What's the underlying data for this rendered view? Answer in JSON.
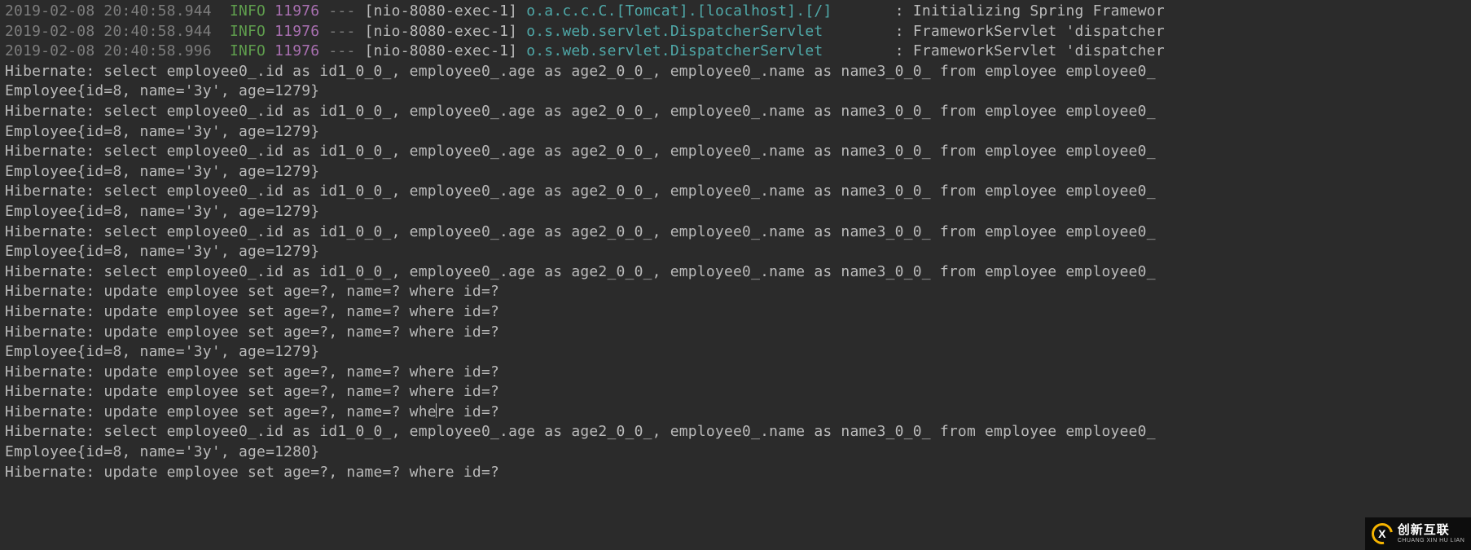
{
  "log_lines": [
    {
      "ts": "2019-02-08 20:40:58.944",
      "level": "INFO",
      "pid": "11976",
      "dash": "---",
      "thread": "[nio-8080-exec-1]",
      "logger": "o.a.c.c.C.[Tomcat].[localhost].[/]",
      "pad": "       ",
      "sep": ":",
      "msg": " Initializing Spring Framewor"
    },
    {
      "ts": "2019-02-08 20:40:58.944",
      "level": "INFO",
      "pid": "11976",
      "dash": "---",
      "thread": "[nio-8080-exec-1]",
      "logger": "o.s.web.servlet.DispatcherServlet",
      "pad": "        ",
      "sep": ":",
      "msg": " FrameworkServlet 'dispatcher"
    },
    {
      "ts": "2019-02-08 20:40:58.996",
      "level": "INFO",
      "pid": "11976",
      "dash": "---",
      "thread": "[nio-8080-exec-1]",
      "logger": "o.s.web.servlet.DispatcherServlet",
      "pad": "        ",
      "sep": ":",
      "msg": " FrameworkServlet 'dispatcher"
    }
  ],
  "plain_lines": [
    "Hibernate: select employee0_.id as id1_0_0_, employee0_.age as age2_0_0_, employee0_.name as name3_0_0_ from employee employee0_ ",
    "Employee{id=8, name='3y', age=1279}",
    "Hibernate: select employee0_.id as id1_0_0_, employee0_.age as age2_0_0_, employee0_.name as name3_0_0_ from employee employee0_ ",
    "Employee{id=8, name='3y', age=1279}",
    "Hibernate: select employee0_.id as id1_0_0_, employee0_.age as age2_0_0_, employee0_.name as name3_0_0_ from employee employee0_ ",
    "Employee{id=8, name='3y', age=1279}",
    "Hibernate: select employee0_.id as id1_0_0_, employee0_.age as age2_0_0_, employee0_.name as name3_0_0_ from employee employee0_ ",
    "Employee{id=8, name='3y', age=1279}",
    "Hibernate: select employee0_.id as id1_0_0_, employee0_.age as age2_0_0_, employee0_.name as name3_0_0_ from employee employee0_ ",
    "Employee{id=8, name='3y', age=1279}",
    "Hibernate: select employee0_.id as id1_0_0_, employee0_.age as age2_0_0_, employee0_.name as name3_0_0_ from employee employee0_ ",
    "Hibernate: update employee set age=?, name=? where id=?",
    "Hibernate: update employee set age=?, name=? where id=?",
    "Hibernate: update employee set age=?, name=? where id=?",
    "Employee{id=8, name='3y', age=1279}",
    "Hibernate: update employee set age=?, name=? where id=?",
    "Hibernate: update employee set age=?, name=? where id=?",
    "Hibernate: update employee set age=?, name=? where id=?",
    "Hibernate: select employee0_.id as id1_0_0_, employee0_.age as age2_0_0_, employee0_.name as name3_0_0_ from employee employee0_ ",
    "Employee{id=8, name='3y', age=1280}",
    "Hibernate: update employee set age=?, name=? where id=?"
  ],
  "watermark": {
    "zh": "创新互联",
    "py": "CHUANG XIN HU LIAN",
    "x": "X"
  },
  "caret_line_index": 17
}
